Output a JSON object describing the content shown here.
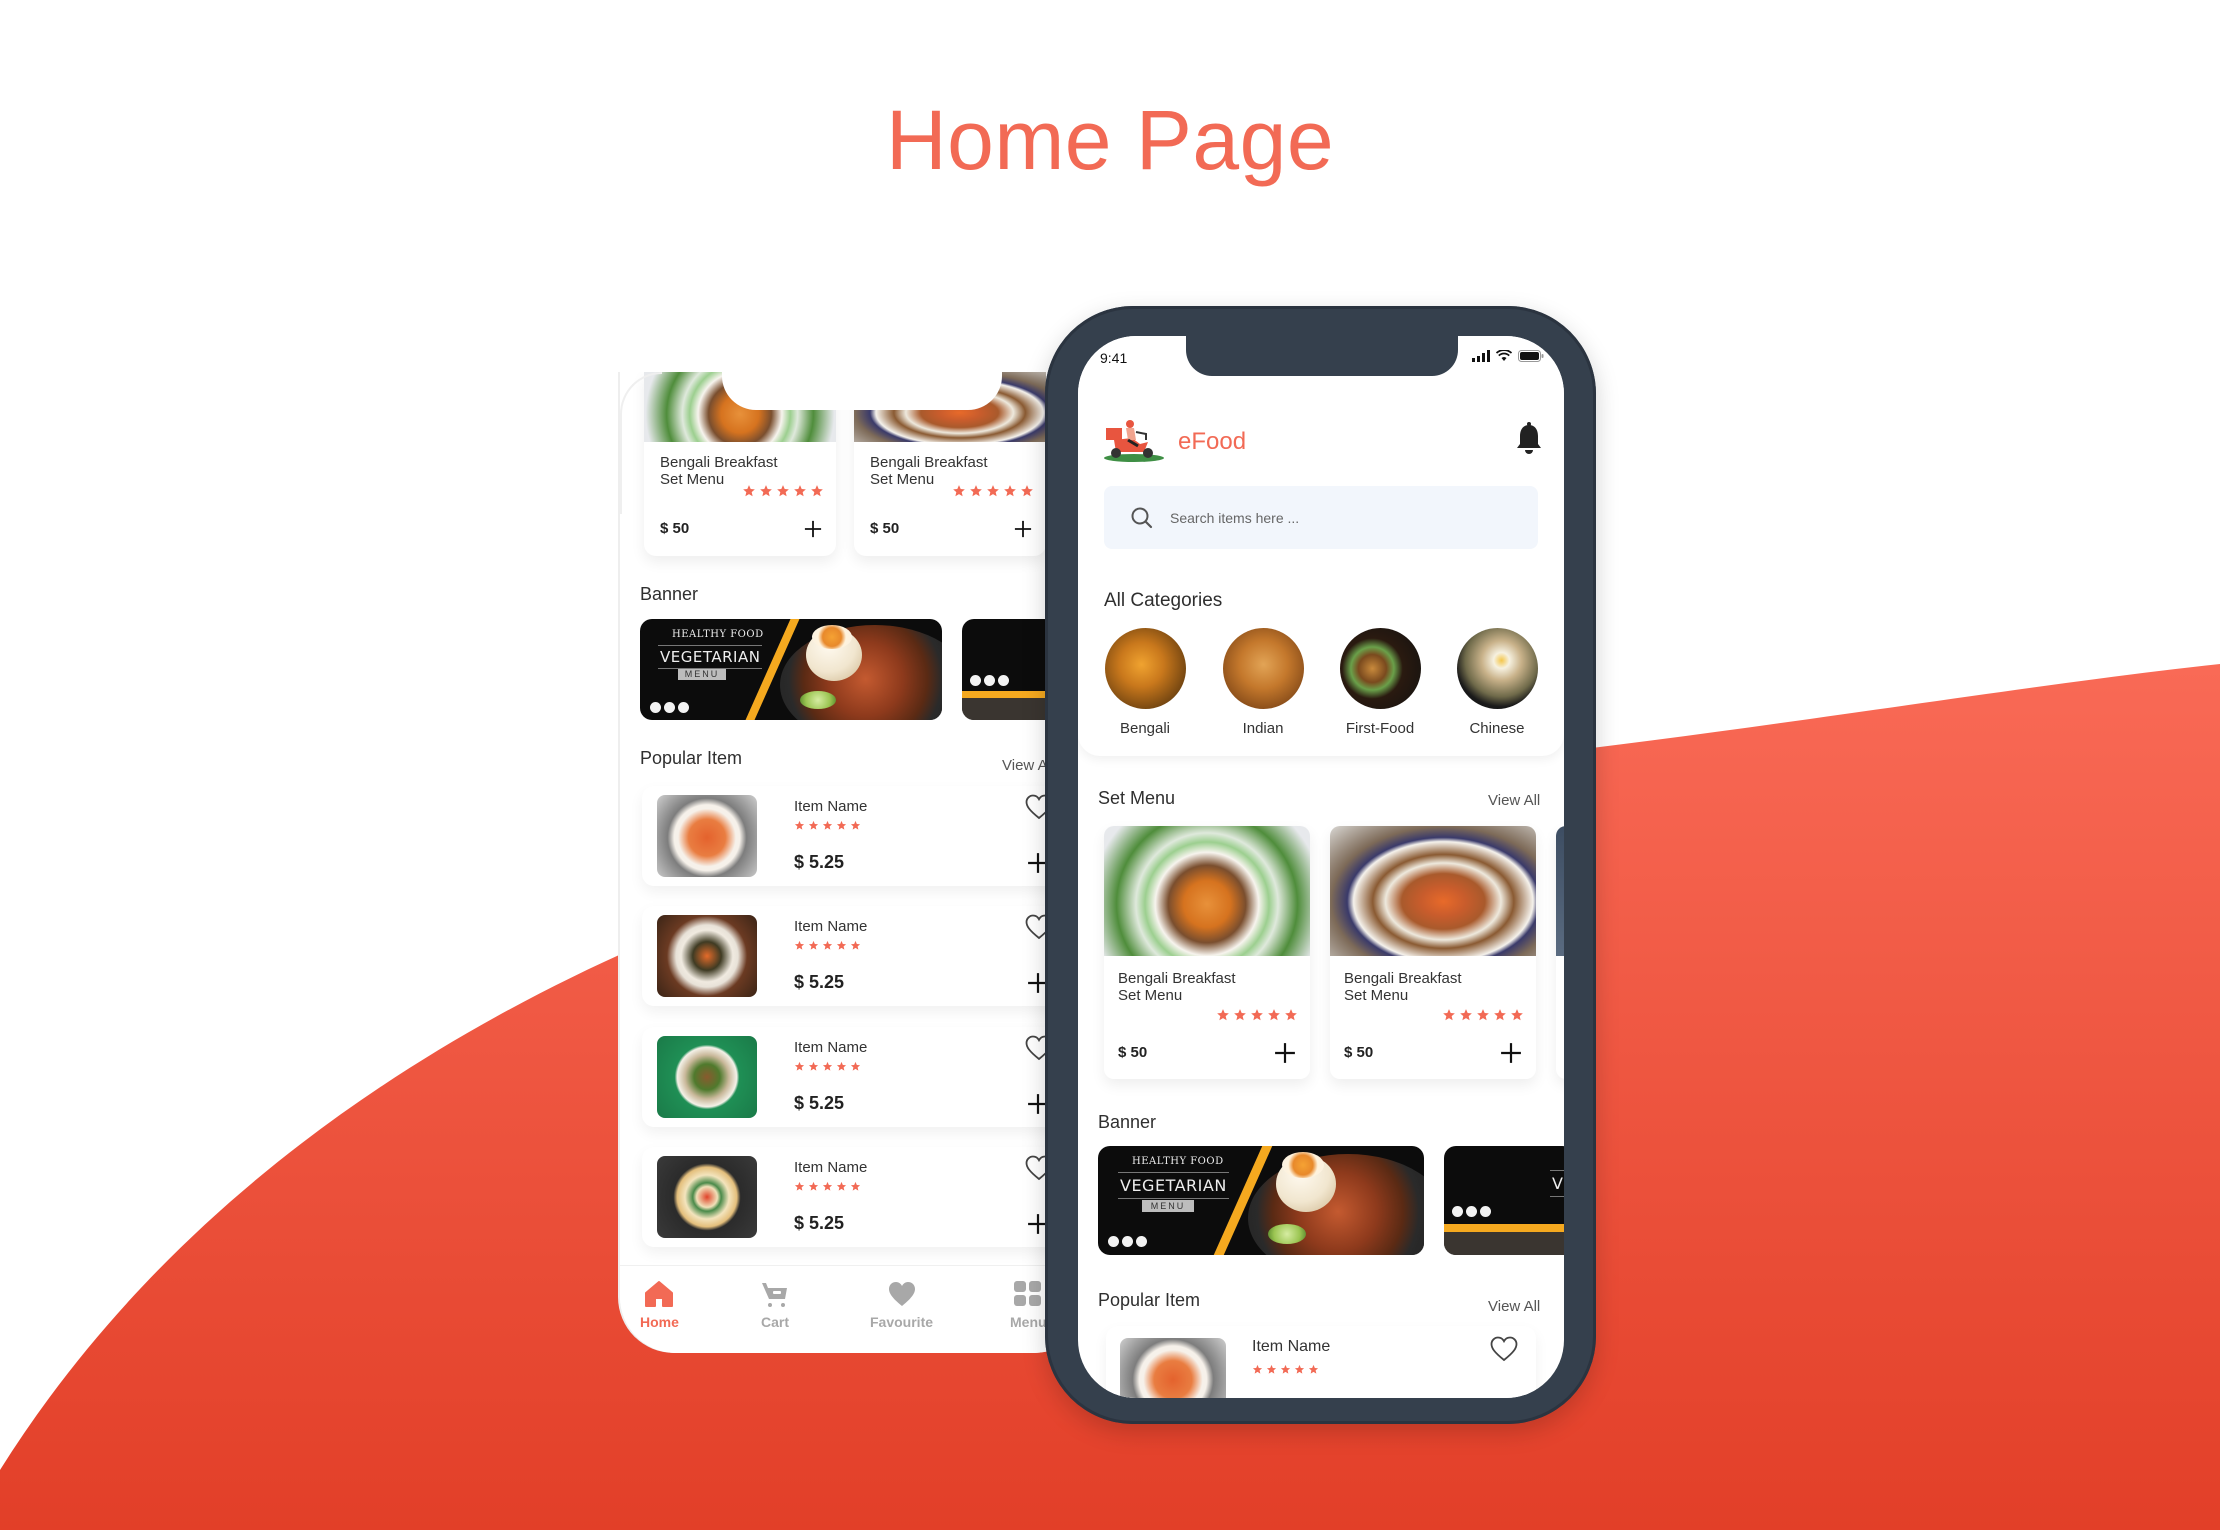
{
  "page": {
    "title": "Home Page",
    "accent_color": "#f26a55",
    "background_wave_color": "#e8432d",
    "phone_frame_color": "#35404d"
  },
  "app": {
    "brand_name": "eFood",
    "status_bar": {
      "time": "9:41"
    },
    "icons": {
      "logo": "delivery-scooter-logo",
      "notification": "bell-icon",
      "search": "search-icon",
      "favorite": "heart-outline-icon",
      "add": "plus-icon",
      "rating": "star-icon"
    },
    "search": {
      "placeholder": "Search items here ..."
    },
    "categories": {
      "title": "All Categories",
      "items": [
        {
          "label": "Bengali"
        },
        {
          "label": "Indian"
        },
        {
          "label": "First-Food"
        },
        {
          "label": "Chinese"
        }
      ]
    },
    "set_menu": {
      "title": "Set Menu",
      "view_all": "View All",
      "items": [
        {
          "name": "Bengali Breakfast\nSet Menu",
          "price": "$ 50",
          "rating": 5
        },
        {
          "name": "Bengali Breakfast\nSet Menu",
          "price": "$ 50",
          "rating": 5
        }
      ]
    },
    "banner": {
      "title": "Banner",
      "items": [
        {
          "kicker": "HEALTHY FOOD",
          "headline": "VEGETARIAN",
          "tag": "MENU"
        },
        {
          "kicker": "",
          "headline": "VE",
          "tag": ""
        }
      ]
    },
    "popular": {
      "title": "Popular Item",
      "view_all": "View All",
      "view_all_truncated": "View A",
      "items": [
        {
          "name": "Item Name",
          "price": "$ 5.25",
          "rating": 5
        },
        {
          "name": "Item Name",
          "price": "$ 5.25",
          "rating": 5
        },
        {
          "name": "Item Name",
          "price": "$ 5.25",
          "rating": 5
        },
        {
          "name": "Item Name",
          "price": "$ 5.25",
          "rating": 5
        }
      ]
    },
    "bottom_nav": {
      "items": [
        {
          "label": "Home",
          "icon": "home-icon",
          "active": true
        },
        {
          "label": "Cart",
          "icon": "cart-icon",
          "active": false
        },
        {
          "label": "Favourite",
          "icon": "heart-icon",
          "active": false
        },
        {
          "label": "Menu",
          "icon": "grid-icon",
          "active": false
        }
      ]
    }
  }
}
